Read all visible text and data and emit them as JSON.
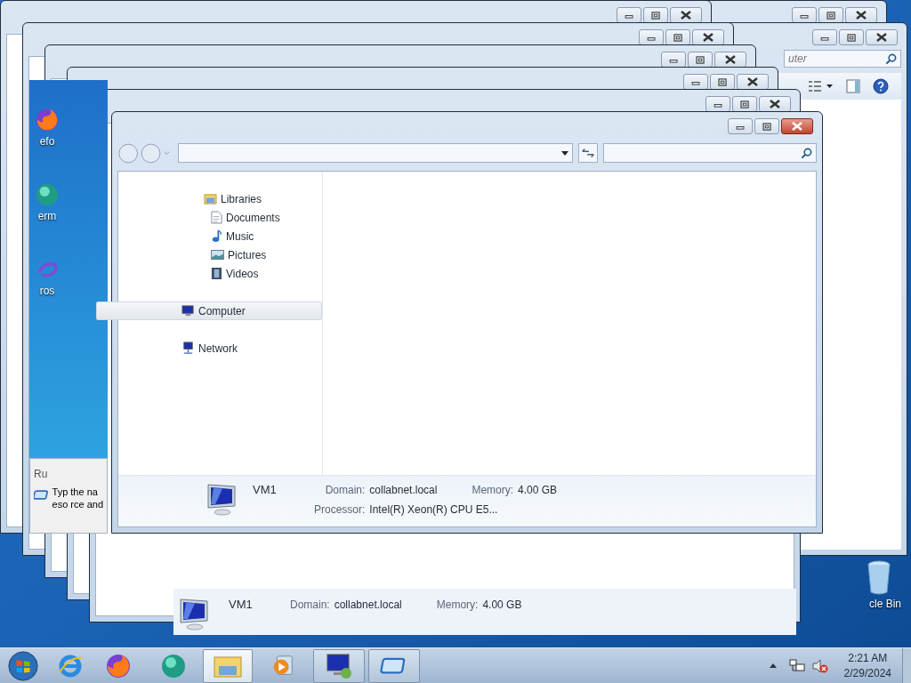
{
  "rear_windows": [
    {
      "active": false
    },
    {
      "active": false,
      "search_placeholder": "uter"
    }
  ],
  "stack_windows": [
    {
      "active": false
    },
    {
      "active": false
    },
    {
      "active": false
    },
    {
      "active": false
    },
    {
      "active": false
    }
  ],
  "desktop_strip": {
    "icons": [
      {
        "label": "efo"
      },
      {
        "label": "erm"
      },
      {
        "label": "ros"
      }
    ]
  },
  "run_dialog": {
    "title": "Ru",
    "lines": [
      "Typ the na",
      "eso rce and"
    ]
  },
  "rear_details": {
    "name": "VM1",
    "fields": [
      {
        "label": "Domain:",
        "value": "collabnet.local"
      },
      {
        "label": "Memory:",
        "value": "4.00 GB"
      }
    ]
  },
  "window": {
    "active": true,
    "nav_tree": [
      {
        "label": "Libraries",
        "selected": false,
        "children": [
          {
            "label": "Documents",
            "selected": false
          },
          {
            "label": "Music",
            "selected": false
          },
          {
            "label": "Pictures",
            "selected": false
          },
          {
            "label": "Videos",
            "selected": false
          }
        ]
      },
      {
        "label": "Computer",
        "selected": true
      },
      {
        "label": "Network",
        "selected": false
      }
    ],
    "details": {
      "name": "VM1",
      "fields": [
        {
          "label": "Domain:",
          "value": "collabnet.local"
        },
        {
          "label": "Memory:",
          "value": "4.00 GB"
        },
        {
          "label": "Processor:",
          "value": "Intel(R) Xeon(R) CPU E5..."
        }
      ]
    }
  },
  "recycle_bin": {
    "label": "cle Bin"
  },
  "taskbar": {
    "apps": [
      {
        "running": false,
        "selected": false
      },
      {
        "running": false,
        "selected": false
      },
      {
        "running": false,
        "selected": false
      },
      {
        "running": true,
        "selected": true
      },
      {
        "running": false,
        "selected": false
      },
      {
        "running": true,
        "selected": false
      },
      {
        "running": true,
        "selected": false
      }
    ],
    "clock": {
      "time": "2:21 AM",
      "date": "2/29/2024"
    }
  }
}
